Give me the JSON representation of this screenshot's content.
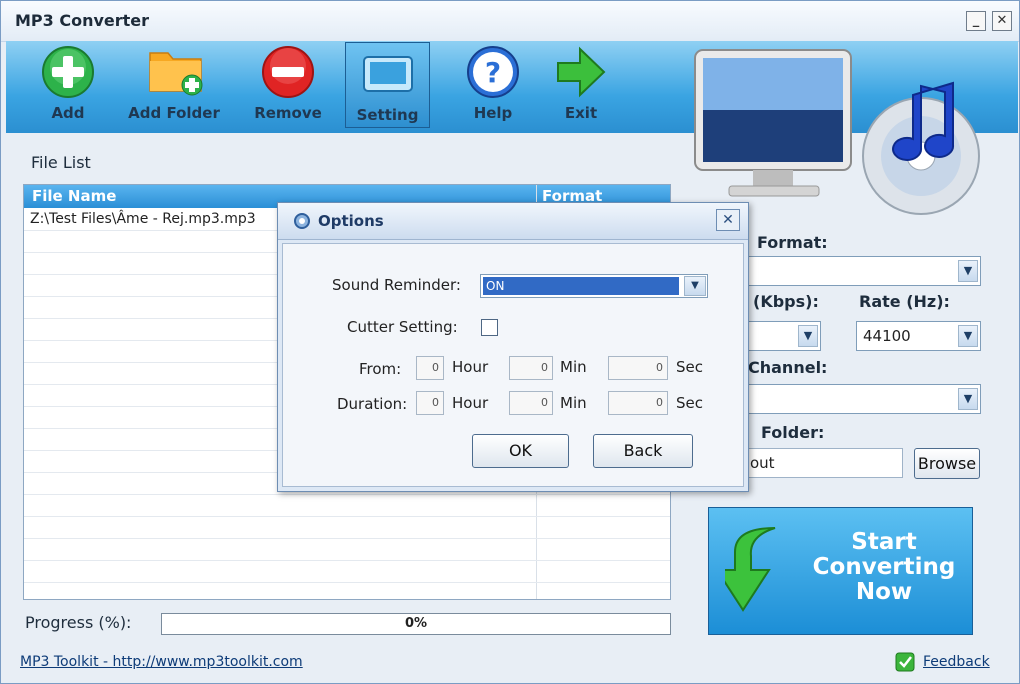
{
  "app": {
    "title": "MP3 Converter"
  },
  "toolbar": {
    "add": "Add",
    "add_folder": "Add Folder",
    "remove": "Remove",
    "setting": "Setting",
    "help": "Help",
    "exit": "Exit"
  },
  "file_list": {
    "label": "File List",
    "columns": {
      "name": "File Name",
      "format": "Format"
    },
    "rows": [
      {
        "name": "Z:\\Test Files\\Âme - Rej.mp3.mp3"
      }
    ]
  },
  "right_panel": {
    "format_label": "Format:",
    "format_value": "",
    "bitrate_label": "(Kbps):",
    "bitrate_value": "",
    "rate_label": "Rate (Hz):",
    "rate_value": "44100",
    "channel_label": "Channel:",
    "channel_value": "",
    "folder_label": "Folder:",
    "folder_value": "out",
    "browse": "Browse"
  },
  "start": {
    "line1": "Start",
    "line2": "Converting",
    "line3": "Now"
  },
  "progress": {
    "label": "Progress (%):",
    "value": "0%"
  },
  "footer": {
    "link": "MP3 Toolkit - http://www.mp3toolkit.com",
    "feedback": "Feedback"
  },
  "options_dialog": {
    "title": "Options",
    "sound_reminder_label": "Sound Reminder:",
    "sound_reminder_value": "ON",
    "cutter_label": "Cutter Setting:",
    "cutter_checked": false,
    "from_label": "From:",
    "duration_label": "Duration:",
    "hour": "Hour",
    "min": "Min",
    "sec": "Sec",
    "from_hour": "0",
    "from_min": "0",
    "from_sec": "0",
    "dur_hour": "0",
    "dur_min": "0",
    "dur_sec": "0",
    "ok": "OK",
    "back": "Back"
  }
}
